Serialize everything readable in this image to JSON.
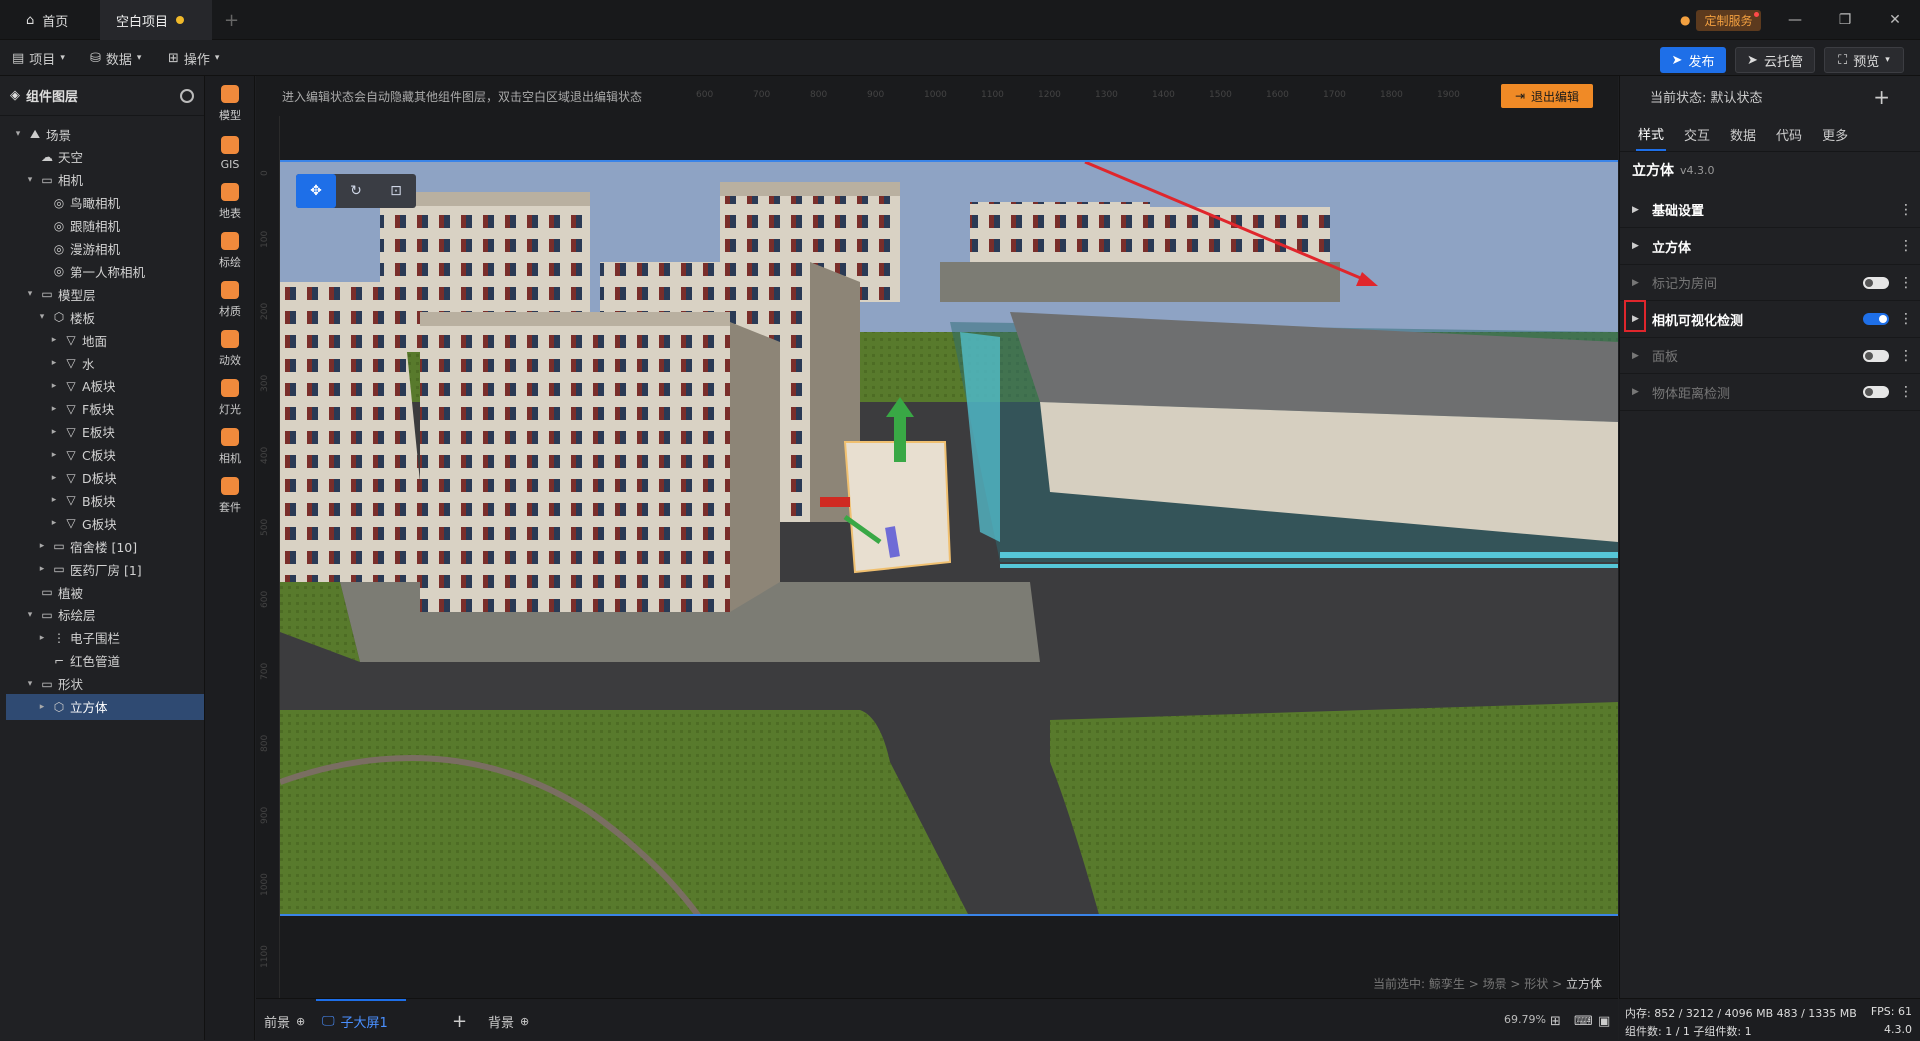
{
  "titlebar": {
    "home_label": "首页",
    "project_label": "空白项目",
    "custom_service": "定制服务"
  },
  "menubar": {
    "items": [
      "项目",
      "数据",
      "操作"
    ],
    "publish": "发布",
    "cloud": "云托管",
    "preview": "预览"
  },
  "layers": {
    "title": "组件图层",
    "tree": [
      {
        "label": "场景",
        "level": 0,
        "icon": "scene-icon",
        "expanded": true
      },
      {
        "label": "天空",
        "level": 1,
        "icon": "sky-icon"
      },
      {
        "label": "相机",
        "level": 1,
        "icon": "folder-icon",
        "expanded": true
      },
      {
        "label": "鸟瞰相机",
        "level": 2,
        "icon": "camera-icon"
      },
      {
        "label": "跟随相机",
        "level": 2,
        "icon": "camera-icon"
      },
      {
        "label": "漫游相机",
        "level": 2,
        "icon": "camera-icon"
      },
      {
        "label": "第一人称相机",
        "level": 2,
        "icon": "camera-icon"
      },
      {
        "label": "模型层",
        "level": 1,
        "icon": "folder-icon",
        "expanded": true
      },
      {
        "label": "楼板",
        "level": 2,
        "icon": "cube-icon",
        "expanded": true
      },
      {
        "label": "地面",
        "level": 3,
        "icon": "model-icon",
        "collapsed": true
      },
      {
        "label": "水",
        "level": 3,
        "icon": "model-icon",
        "collapsed": true
      },
      {
        "label": "A板块",
        "level": 3,
        "icon": "model-icon",
        "collapsed": true
      },
      {
        "label": "F板块",
        "level": 3,
        "icon": "model-icon",
        "collapsed": true
      },
      {
        "label": "E板块",
        "level": 3,
        "icon": "model-icon",
        "collapsed": true
      },
      {
        "label": "C板块",
        "level": 3,
        "icon": "model-icon",
        "collapsed": true
      },
      {
        "label": "D板块",
        "level": 3,
        "icon": "model-icon",
        "collapsed": true
      },
      {
        "label": "B板块",
        "level": 3,
        "icon": "model-icon",
        "collapsed": true
      },
      {
        "label": "G板块",
        "level": 3,
        "icon": "model-icon",
        "collapsed": true
      },
      {
        "label": "宿舍楼 [10]",
        "level": 2,
        "icon": "folder-icon",
        "collapsed": true
      },
      {
        "label": "医药厂房 [1]",
        "level": 2,
        "icon": "folder-icon",
        "collapsed": true
      },
      {
        "label": "植被",
        "level": 1,
        "icon": "folder-icon"
      },
      {
        "label": "标绘层",
        "level": 1,
        "icon": "folder-icon",
        "expanded": true
      },
      {
        "label": "电子围栏",
        "level": 2,
        "icon": "fence-icon",
        "collapsed": true
      },
      {
        "label": "红色管道",
        "level": 2,
        "icon": "pipe-icon"
      },
      {
        "label": "形状",
        "level": 1,
        "icon": "folder-icon",
        "expanded": true
      },
      {
        "label": "立方体",
        "level": 2,
        "icon": "cube-icon",
        "collapsed": true,
        "selected": true
      }
    ]
  },
  "toolbox": [
    "模型",
    "GIS",
    "地表",
    "标绘",
    "材质",
    "动效",
    "灯光",
    "相机",
    "套件"
  ],
  "canvas": {
    "hint": "进入编辑状态会自动隐藏其他组件图层，双击空白区域退出编辑状态",
    "exit_edit": "退出编辑",
    "selection_prefix": "当前选中: 鲸孪生 > 场景 > 形状 >",
    "selection_current": "立方体",
    "ruler_top": [
      "600",
      "700",
      "800",
      "900",
      "1000",
      "1100",
      "1200",
      "1300",
      "1400",
      "1500",
      "1600",
      "1700",
      "1800",
      "1900"
    ],
    "ruler_left": [
      "0",
      "100",
      "200",
      "300",
      "400",
      "500",
      "600",
      "700",
      "800",
      "900",
      "1000",
      "1100"
    ]
  },
  "bottom": {
    "foreground": "前景",
    "sub_screen": "子大屏1",
    "background": "背景",
    "zoom": "69.79%"
  },
  "props": {
    "state_label": "当前状态: 默认状态",
    "tabs": [
      "样式",
      "交互",
      "数据",
      "代码",
      "更多"
    ],
    "component_name": "立方体",
    "version": "v4.3.0",
    "sections": [
      {
        "label": "基础设置",
        "style": "bold"
      },
      {
        "label": "立方体",
        "style": "bold"
      },
      {
        "label": "标记为房间",
        "style": "dim",
        "toggle": false
      },
      {
        "label": "相机可视化检测",
        "style": "bold",
        "toggle": true
      },
      {
        "label": "面板",
        "style": "dim",
        "toggle": false
      },
      {
        "label": "物体距离检测",
        "style": "dim",
        "toggle": false
      }
    ]
  },
  "status": {
    "memory": "内存: 852 / 3212 / 4096 MB  483 / 1335 MB",
    "fps": "FPS: 61",
    "components": "组件数: 1 / 1  子组件数: 1",
    "version": "4.3.0"
  },
  "colors": {
    "accent": "#1e6fe8",
    "orange": "#f08a26",
    "annotation_red": "#e0262c"
  }
}
